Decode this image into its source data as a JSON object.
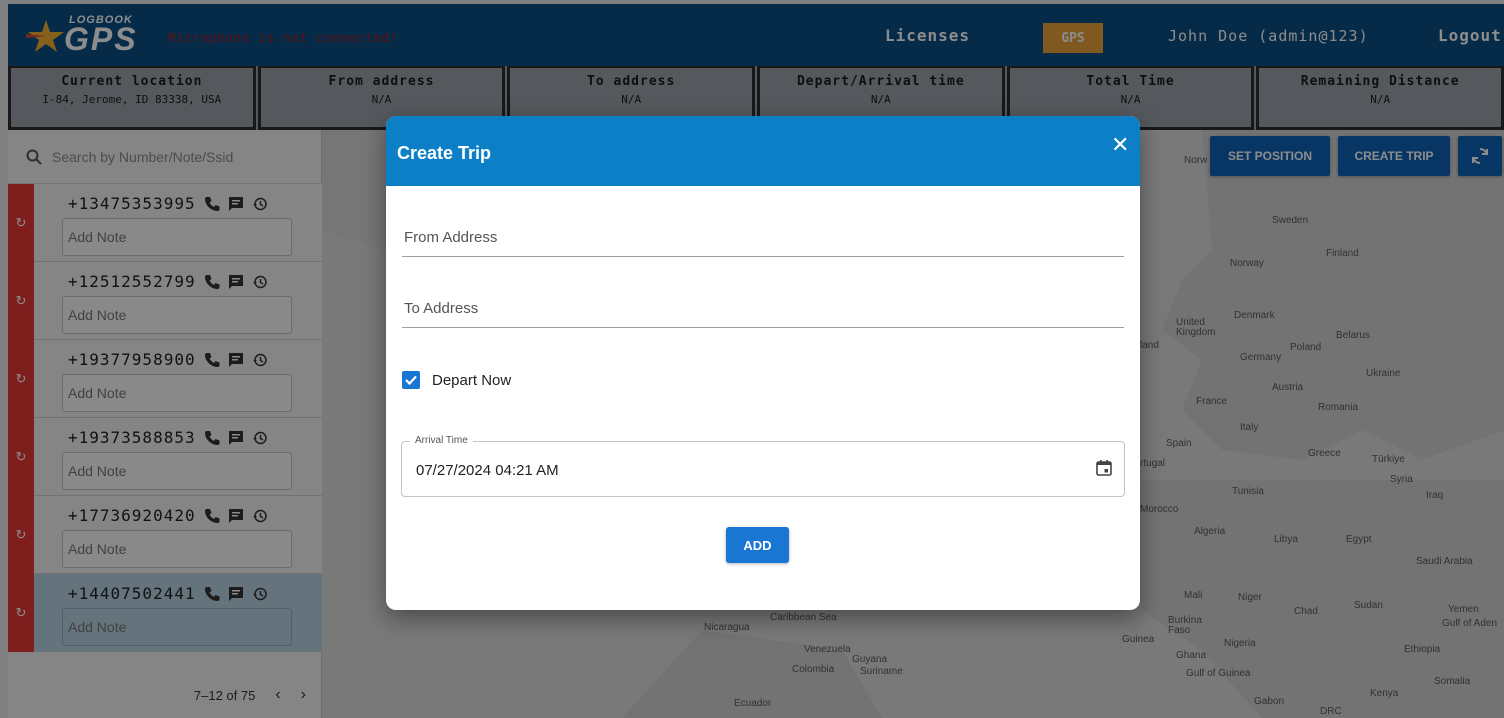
{
  "header": {
    "logo_top": "LOGBOOK",
    "logo_main": "GPS",
    "mic_warning": "Microphone is not connected!",
    "nav_licenses": "Licenses",
    "gps_badge": "GPS",
    "user": "John Doe (admin@123)",
    "logout": "Logout"
  },
  "info": [
    {
      "label": "Current location",
      "value": "I-84, Jerome, ID 83338, USA"
    },
    {
      "label": "From address",
      "value": "N/A"
    },
    {
      "label": "To address",
      "value": "N/A"
    },
    {
      "label": "Depart/Arrival time",
      "value": "N/A"
    },
    {
      "label": "Total Time",
      "value": "N/A"
    },
    {
      "label": "Remaining Distance",
      "value": "N/A"
    }
  ],
  "sidebar": {
    "search_placeholder": "Search by Number/Note/Ssid",
    "note_placeholder": "Add Note",
    "contacts": [
      {
        "phone": "+13475353995"
      },
      {
        "phone": "+12512552799"
      },
      {
        "phone": "+19377958900"
      },
      {
        "phone": "+19373588853"
      },
      {
        "phone": "+17736920420"
      },
      {
        "phone": "+14407502441"
      }
    ],
    "pager": "7–12 of 75"
  },
  "map": {
    "buttons": {
      "set_position": "SET POSITION",
      "create_trip": "CREATE TRIP"
    },
    "labels": [
      "Sweden",
      "Finland",
      "Norway",
      "Denmark",
      "United Kingdom",
      "Belarus",
      "Poland",
      "Germany",
      "Ukraine",
      "Austria",
      "France",
      "Romania",
      "Italy",
      "Spain",
      "Greece",
      "Türkiye",
      "Syria",
      "Iraq",
      "Tunisia",
      "Morocco",
      "Algeria",
      "Libya",
      "Egypt",
      "Saudi Arabia",
      "Mali",
      "Niger",
      "Chad",
      "Sudan",
      "Yemen",
      "Burkina Faso",
      "Nigeria",
      "Ghana",
      "Guinea",
      "Ethiopia",
      "Somalia",
      "Kenya",
      "Gabon",
      "DRC",
      "Nicaragua",
      "Venezuela",
      "Guyana",
      "Suriname",
      "Colombia",
      "Ecuador",
      "Norw",
      "rtugal",
      "land",
      "Gulf of Guinea",
      "Gulf of Aden",
      "Caribbean Sea"
    ]
  },
  "dialog": {
    "title": "Create Trip",
    "from_placeholder": "From Address",
    "to_placeholder": "To Address",
    "depart_now_label": "Depart Now",
    "depart_now_checked": true,
    "arrival_label": "Arrival Time",
    "arrival_value": "07/27/2024 04:21 AM",
    "add_label": "ADD"
  },
  "colors": {
    "header_bg": "#0b4f85",
    "accent": "#0d7fc7",
    "button": "#1976d2",
    "gps_badge": "#e8a23a",
    "status_red": "#e53935",
    "selected_row": "#b7d1e2"
  }
}
